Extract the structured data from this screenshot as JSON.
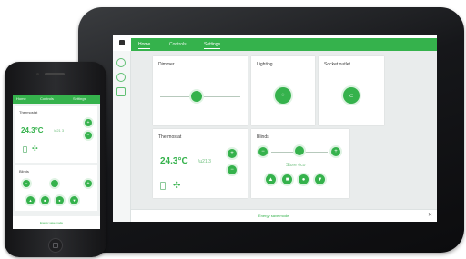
{
  "tablet": {
    "nav": [
      "Home",
      "Controls",
      "Settings"
    ],
    "cards": {
      "dimmer": {
        "title": "Dimmer",
        "level": 0.45
      },
      "lighting": {
        "title": "Lighting"
      },
      "socket": {
        "title": "Socket outlet"
      },
      "thermostat": {
        "title": "Thermostat",
        "temperature": "24.3°C",
        "secondary": "\\u21 3"
      },
      "blinds": {
        "title": "Blinds",
        "position_label": "Store éco",
        "level": 0.5
      }
    },
    "footer_link": "Energy save mode"
  },
  "phone": {
    "nav": [
      "Home",
      "Controls",
      "Settings"
    ],
    "cards": {
      "thermostat": {
        "title": "Thermostat",
        "temperature": "24.3°C",
        "secondary": "\\u21 3"
      },
      "blinds": {
        "title": "Blinds",
        "level": 0.45
      }
    },
    "footer_link": "Energy save mode"
  },
  "colors": {
    "accent": "#35b24c",
    "screen_bg": "#e9ecec"
  }
}
